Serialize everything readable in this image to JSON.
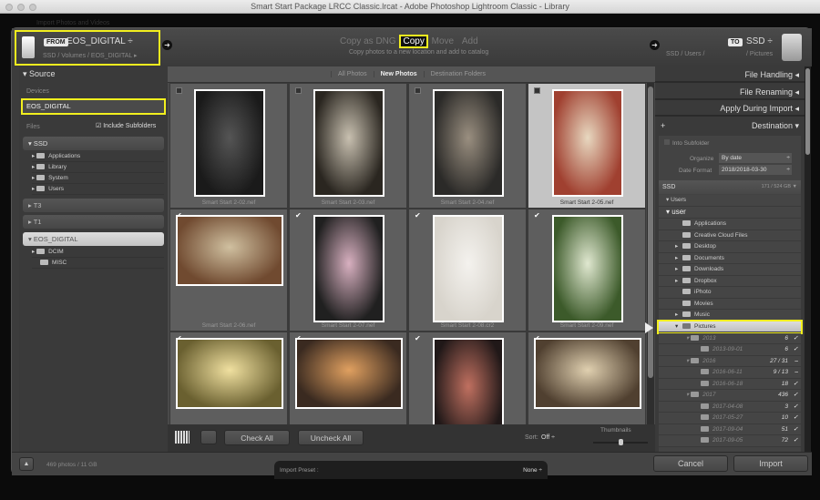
{
  "window": {
    "title": "Smart Start Package LRCC Classic.lrcat - Adobe Photoshop Lightroom Classic - Library",
    "behind_text": "Import Photos and Videos"
  },
  "header": {
    "from_tag": "FROM",
    "from_device": "EOS_DIGITAL ÷",
    "from_path": "SSD / Volumes / EOS_DIGITAL ▸",
    "modes": [
      "Copy as DNG",
      "Copy",
      "Move",
      "Add"
    ],
    "active_mode": "Copy",
    "mode_desc": "Copy photos to a new location and add to catalog",
    "to_path_left": "SSD / Users /",
    "to_tag": "TO",
    "to_device": "SSD ÷",
    "to_path_right": "/ Pictures"
  },
  "source": {
    "title": "Source",
    "devices_label": "Devices",
    "device": "EOS_DIGITAL",
    "files_label": "Files",
    "include_subfolders": "Include Subfolders",
    "volumes": [
      {
        "name": "SSD",
        "expanded": true,
        "folders": [
          "Applications",
          "Library",
          "System",
          "Users"
        ]
      },
      {
        "name": "T3",
        "expanded": false,
        "folders": []
      },
      {
        "name": "T1",
        "expanded": false,
        "folders": []
      },
      {
        "name": "EOS_DIGITAL",
        "expanded": true,
        "selected": true,
        "folders": [
          "DCIM",
          "MISC"
        ]
      }
    ]
  },
  "view_tabs": [
    "All Photos",
    "New Photos",
    "Destination Folders"
  ],
  "active_tab": "New Photos",
  "photos": [
    {
      "file": "Smart Start 2-02.nef",
      "checked": false
    },
    {
      "file": "Smart Start 2-03.nef",
      "checked": false
    },
    {
      "file": "Smart Start 2-04.nef",
      "checked": false
    },
    {
      "file": "Smart Start 2-05.nef",
      "checked": false,
      "selected": true
    },
    {
      "file": "Smart Start 2-06.nef",
      "checked": true
    },
    {
      "file": "Smart Start 2-07.nef",
      "checked": true
    },
    {
      "file": "Smart Start 2-08.cr2",
      "checked": true
    },
    {
      "file": "Smart Start 2-09.nef",
      "checked": true
    },
    {
      "file": "",
      "checked": true
    },
    {
      "file": "",
      "checked": true
    },
    {
      "file": "",
      "checked": true
    },
    {
      "file": "",
      "checked": true
    }
  ],
  "toolbar": {
    "check_all": "Check All",
    "uncheck_all": "Uncheck All",
    "sort_label": "Sort:",
    "sort_value": "Off ÷",
    "thumbnails_label": "Thumbnails",
    "thumbnail_size": 0.5
  },
  "right": {
    "sections": [
      "File Handling",
      "File Renaming",
      "Apply During Import"
    ],
    "destination": "Destination",
    "into_subfolder": "Into Subfolder",
    "organize_label": "Organize",
    "organize_value": "By date",
    "date_format_label": "Date Format",
    "date_format_value": "2018/2018-03-30",
    "volume": "SSD",
    "volume_space": "171 / 524 GB",
    "users": "Users",
    "user": "user",
    "folders": [
      "Applications",
      "Creative Cloud Files",
      "Desktop",
      "Documents",
      "Downloads",
      "Dropbox",
      "iPhoto",
      "Movies",
      "Music"
    ],
    "selected_folder": "Pictures",
    "subfolders": [
      {
        "name": "2013",
        "count": "6",
        "state": "✓",
        "level": 1
      },
      {
        "name": "2013-09-01",
        "count": "6",
        "state": "✓",
        "level": 2
      },
      {
        "name": "2016",
        "count": "27 / 31",
        "state": "–",
        "level": 1
      },
      {
        "name": "2016-06-11",
        "count": "9 / 13",
        "state": "–",
        "level": 2
      },
      {
        "name": "2016-06-18",
        "count": "18",
        "state": "✓",
        "level": 2
      },
      {
        "name": "2017",
        "count": "436",
        "state": "✓",
        "level": 1
      },
      {
        "name": "2017-04-08",
        "count": "3",
        "state": "✓",
        "level": 2
      },
      {
        "name": "2017-05-27",
        "count": "10",
        "state": "✓",
        "level": 2
      },
      {
        "name": "2017-09-04",
        "count": "51",
        "state": "✓",
        "level": 2
      },
      {
        "name": "2017-09-05",
        "count": "72",
        "state": "✓",
        "level": 2
      }
    ]
  },
  "bottom": {
    "summary": "469 photos / 11 GB",
    "preset_label": "Import Preset :",
    "preset_value": "None ÷",
    "cancel": "Cancel",
    "import": "Import"
  },
  "colors": {
    "highlight": "#f2ef1e",
    "panel": "#3c3c3c"
  }
}
